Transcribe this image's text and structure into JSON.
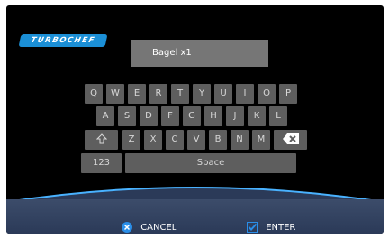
{
  "brand": {
    "logo_text": "TURBOCHEF",
    "color": "#1b8fd6"
  },
  "input": {
    "value": "Bagel x1"
  },
  "keyboard": {
    "row1": [
      "Q",
      "W",
      "E",
      "R",
      "T",
      "Y",
      "U",
      "I",
      "O",
      "P"
    ],
    "row2": [
      "A",
      "S",
      "D",
      "F",
      "G",
      "H",
      "J",
      "K",
      "L"
    ],
    "row3": [
      "shift-icon",
      "Z",
      "X",
      "C",
      "V",
      "B",
      "N",
      "M",
      "backspace-icon"
    ],
    "numbers_label": "123",
    "space_label": "Space"
  },
  "footer": {
    "cancel_label": "CANCEL",
    "enter_label": "ENTER",
    "accent": "#2a8ee8"
  }
}
